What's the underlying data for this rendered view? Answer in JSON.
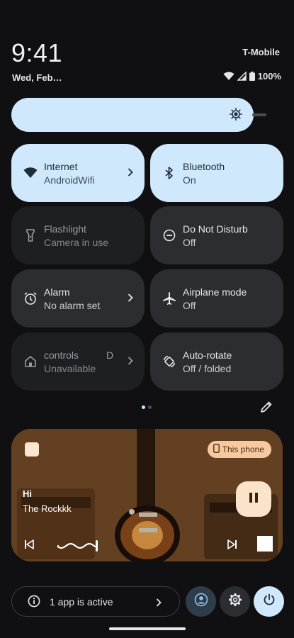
{
  "status": {
    "time": "9:41",
    "date": "Wed, Feb…",
    "carrier": "T-Mobile",
    "battery": "100%"
  },
  "brightness": {
    "level_fraction": 0.88
  },
  "tiles": [
    {
      "title": "Internet",
      "subtitle": "AndroidWifi",
      "icon": "wifi-icon",
      "state": "active",
      "has_chevron": true
    },
    {
      "title": "Bluetooth",
      "subtitle": "On",
      "icon": "bluetooth-icon",
      "state": "active",
      "has_chevron": false
    },
    {
      "title": "Flashlight",
      "subtitle": "Camera in use",
      "icon": "flashlight-icon",
      "state": "disabled",
      "has_chevron": false
    },
    {
      "title": "Do Not Disturb",
      "subtitle": "Off",
      "icon": "do-not-disturb-icon",
      "state": "off",
      "has_chevron": false
    },
    {
      "title": "Alarm",
      "subtitle": "No alarm set",
      "icon": "alarm-icon",
      "state": "off",
      "has_chevron": true
    },
    {
      "title": "Airplane mode",
      "subtitle": "Off",
      "icon": "airplane-icon",
      "state": "off",
      "has_chevron": false
    },
    {
      "title": "controls",
      "title_suffix": "D",
      "subtitle": "Unavailable",
      "icon": "home-icon",
      "state": "disabled",
      "has_chevron": true
    },
    {
      "title": "Auto-rotate",
      "subtitle": "Off / folded",
      "icon": "auto-rotate-icon",
      "state": "off",
      "has_chevron": false
    }
  ],
  "pager": {
    "pages": 2,
    "current": 1
  },
  "media": {
    "device_label": "This phone",
    "title": "Hi",
    "artist": "The Rockkk",
    "progress_fraction": 0.25
  },
  "footer": {
    "active_apps_label": "1 app is active"
  },
  "colors": {
    "accent": "#cfe8fb",
    "tile_off": "#2b2d31",
    "tile_disabled": "#1d1f22",
    "background": "#101012",
    "media_chip": "#f6c9a1"
  }
}
